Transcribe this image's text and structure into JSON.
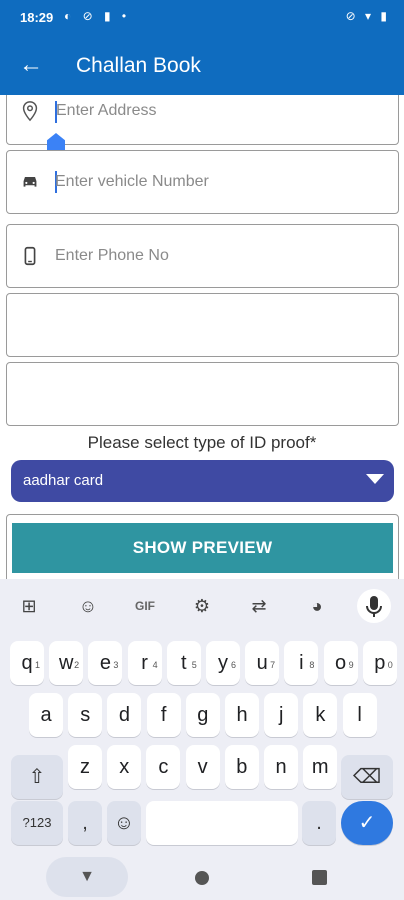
{
  "status_bar": {
    "time": "18:29",
    "left_icons": "◐ ⊘ ▮ •",
    "right_icons": "⊘ ▾ ▮"
  },
  "app_bar": {
    "title": "Challan Book",
    "back_icon": "←"
  },
  "form": {
    "address_placeholder": "Enter Address",
    "vehicle_placeholder": "Enter vehicle Number",
    "phone_placeholder": "Enter Phone No",
    "extra_field_1": "",
    "extra_field_2": "",
    "id_label": "Please select  type of ID proof*",
    "id_selected": "aadhar card",
    "preview_button": "SHOW PREVIEW"
  },
  "keyboard": {
    "toolbar": {
      "grid": "⊞",
      "sticker": "☺",
      "gif": "GIF",
      "settings": "⚙",
      "translate": "⇄",
      "palette": "◕",
      "mic": "🎤"
    },
    "row1": [
      {
        "k": "q",
        "h": "1"
      },
      {
        "k": "w",
        "h": "2"
      },
      {
        "k": "e",
        "h": "3"
      },
      {
        "k": "r",
        "h": "4"
      },
      {
        "k": "t",
        "h": "5"
      },
      {
        "k": "y",
        "h": "6"
      },
      {
        "k": "u",
        "h": "7"
      },
      {
        "k": "i",
        "h": "8"
      },
      {
        "k": "o",
        "h": "9"
      },
      {
        "k": "p",
        "h": "0"
      }
    ],
    "row2": [
      "a",
      "s",
      "d",
      "f",
      "g",
      "h",
      "j",
      "k",
      "l"
    ],
    "row3": [
      "z",
      "x",
      "c",
      "v",
      "b",
      "n",
      "m"
    ],
    "shift": "⇧",
    "backspace": "⌫",
    "symbols": "?123",
    "comma": ",",
    "emoji": "☺",
    "period": ".",
    "enter": "✓"
  },
  "nav_bar": {
    "back": "▼"
  }
}
